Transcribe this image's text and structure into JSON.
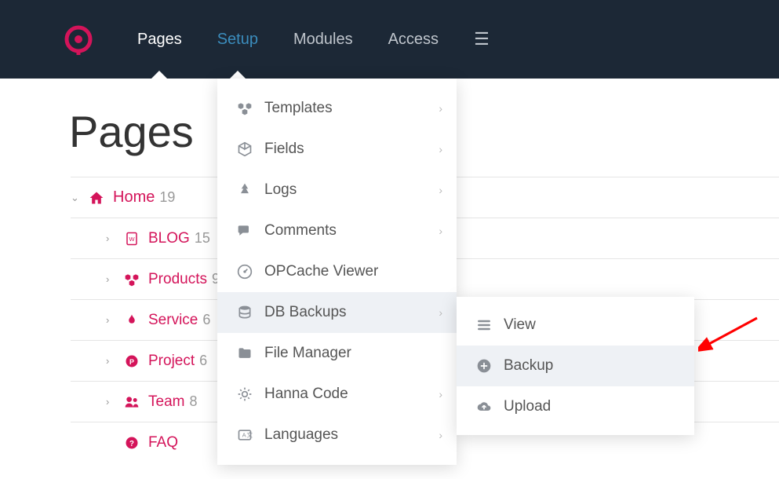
{
  "nav": {
    "pages": "Pages",
    "setup": "Setup",
    "modules": "Modules",
    "access": "Access"
  },
  "page_title": "Pages",
  "tree": {
    "home": {
      "label": "Home",
      "count": "19"
    },
    "blog": {
      "label": "BLOG",
      "count": "15"
    },
    "products": {
      "label": "Products",
      "count": "9"
    },
    "service": {
      "label": "Service",
      "count": "6"
    },
    "project": {
      "label": "Project",
      "count": "6"
    },
    "team": {
      "label": "Team",
      "count": "8"
    },
    "faq": {
      "label": "FAQ"
    }
  },
  "setup_menu": {
    "templates": "Templates",
    "fields": "Fields",
    "logs": "Logs",
    "comments": "Comments",
    "opcache": "OPCache Viewer",
    "dbbackups": "DB Backups",
    "filemanager": "File Manager",
    "hannacode": "Hanna Code",
    "languages": "Languages"
  },
  "db_submenu": {
    "view": "View",
    "backup": "Backup",
    "upload": "Upload"
  }
}
